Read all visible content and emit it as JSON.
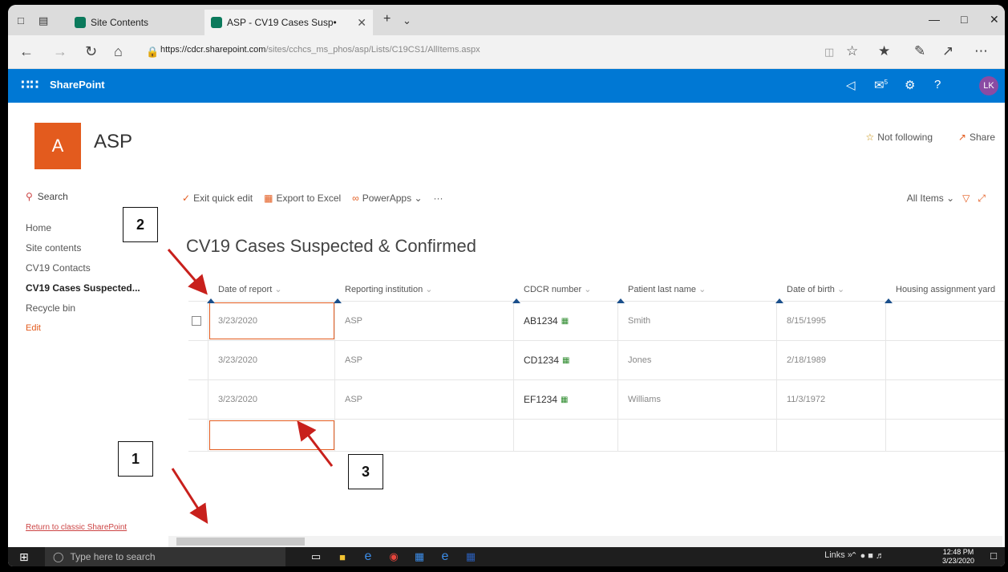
{
  "browser": {
    "tabs": [
      {
        "label": "Site Contents"
      },
      {
        "label": "ASP - CV19 Cases Susp•"
      }
    ],
    "url_host": "https://cdcr.sharepoint.com",
    "url_path": "/sites/cchcs_ms_phos/asp/Lists/C19CS1/AllItems.aspx"
  },
  "suite": {
    "title": "SharePoint",
    "notification_count": "5",
    "avatar_initials": "LK"
  },
  "site": {
    "logo_letter": "A",
    "name": "ASP",
    "follow_label": "Not following",
    "share_label": "Share"
  },
  "leftnav": {
    "search_label": "Search",
    "items": [
      {
        "label": "Home"
      },
      {
        "label": "Site contents"
      },
      {
        "label": "CV19 Contacts"
      },
      {
        "label": "CV19 Cases Suspected..."
      },
      {
        "label": "Recycle bin"
      }
    ],
    "edit_label": "Edit",
    "classic_link": "Return to classic SharePoint"
  },
  "commands": {
    "exit_quick_edit": "Exit quick edit",
    "export_excel": "Export to Excel",
    "powerapps": "PowerApps",
    "more": "···",
    "view": "All Items"
  },
  "list": {
    "title": "CV19 Cases Suspected & Confirmed",
    "columns": [
      "Date of report",
      "Reporting institution",
      "CDCR number",
      "Patient last name",
      "Date of birth",
      "Housing assignment yard"
    ],
    "rows": [
      [
        "3/23/2020",
        "ASP",
        "AB1234",
        "Smith",
        "8/15/1995",
        ""
      ],
      [
        "3/23/2020",
        "ASP",
        "CD1234",
        "Jones",
        "2/18/1989",
        ""
      ],
      [
        "3/23/2020",
        "ASP",
        "EF1234",
        "Williams",
        "11/3/1972",
        ""
      ]
    ]
  },
  "callouts": {
    "one": "1",
    "two": "2",
    "three": "3"
  },
  "taskbar": {
    "search_placeholder": "Type here to search",
    "links_label": "Links",
    "time": "12:48 PM",
    "date": "3/23/2020"
  }
}
